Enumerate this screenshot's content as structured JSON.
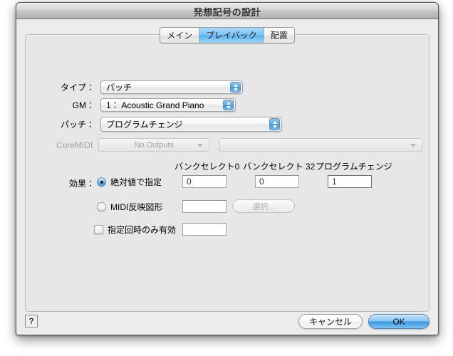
{
  "window": {
    "title": "発想記号の設計"
  },
  "tabs": [
    {
      "label": "メイン",
      "selected": false
    },
    {
      "label": "プレイバック",
      "selected": true
    },
    {
      "label": "配置",
      "selected": false
    }
  ],
  "form": {
    "type_row": {
      "label": "タイプ：",
      "value": "パッチ"
    },
    "gm_row": {
      "label": "GM：",
      "value": "1： Acoustic Grand Piano"
    },
    "patch_row": {
      "label": "パッチ：",
      "value": "プログラムチェンジ"
    },
    "coremidi_row": {
      "label": "CoreMIDI",
      "device_value": "No Outputs",
      "port_value": ""
    }
  },
  "columns": {
    "bank_select_0": "バンクセレクト0",
    "bank_select_32": "バンクセレクト 32",
    "program_change": "プログラムチェンジ"
  },
  "effect": {
    "label": "効果：",
    "absolute": {
      "label": "絶対値で指定",
      "selected": true,
      "bank0": "0",
      "bank32": "0",
      "program": "1"
    },
    "midi_shape": {
      "label": "MIDI反映図形",
      "selected": false,
      "value": "",
      "choose_button": "選択..."
    },
    "only_on_count": {
      "label": "指定回時のみ有効",
      "checked": false,
      "value": ""
    }
  },
  "footer": {
    "help_label": "?",
    "cancel_label": "キャンセル",
    "ok_label": "OK"
  },
  "colors": {
    "accent_blue": "#3d9ae4",
    "tab_selected": "#52b2f2",
    "window_bg": "#ececec",
    "tabbox_bg": "#e7e7e7"
  }
}
